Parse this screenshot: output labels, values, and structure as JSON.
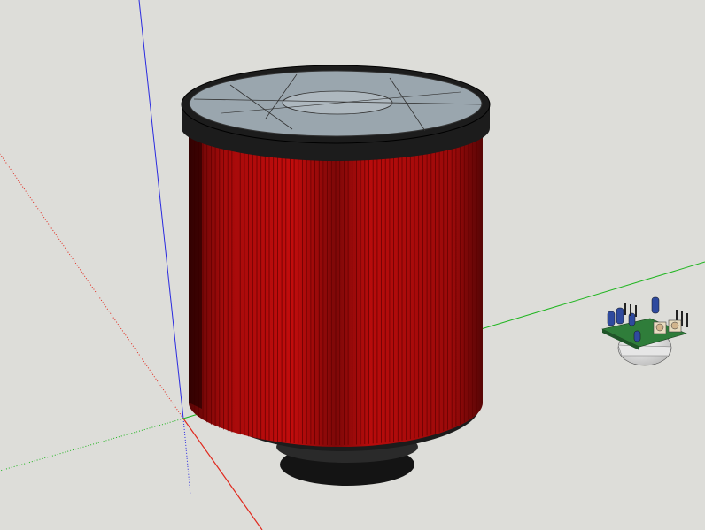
{
  "scene": {
    "background_color": "#ddddd9",
    "axes": {
      "red_axis_color": "#e0291e",
      "green_axis_color": "#20b520",
      "blue_axis_color": "#2a2ae0"
    },
    "objects": [
      {
        "name": "air-filter",
        "pleat_color": "#c10c0c",
        "pleat_shadow_color": "#5e0000",
        "cap_color": "#1c1c1c",
        "lid_color": "#9aa6ae"
      },
      {
        "name": "sensor-module",
        "board_color": "#2f7d3a",
        "capacitor_color": "#2f4a9e",
        "dome_color": "#eeeeee"
      }
    ]
  }
}
